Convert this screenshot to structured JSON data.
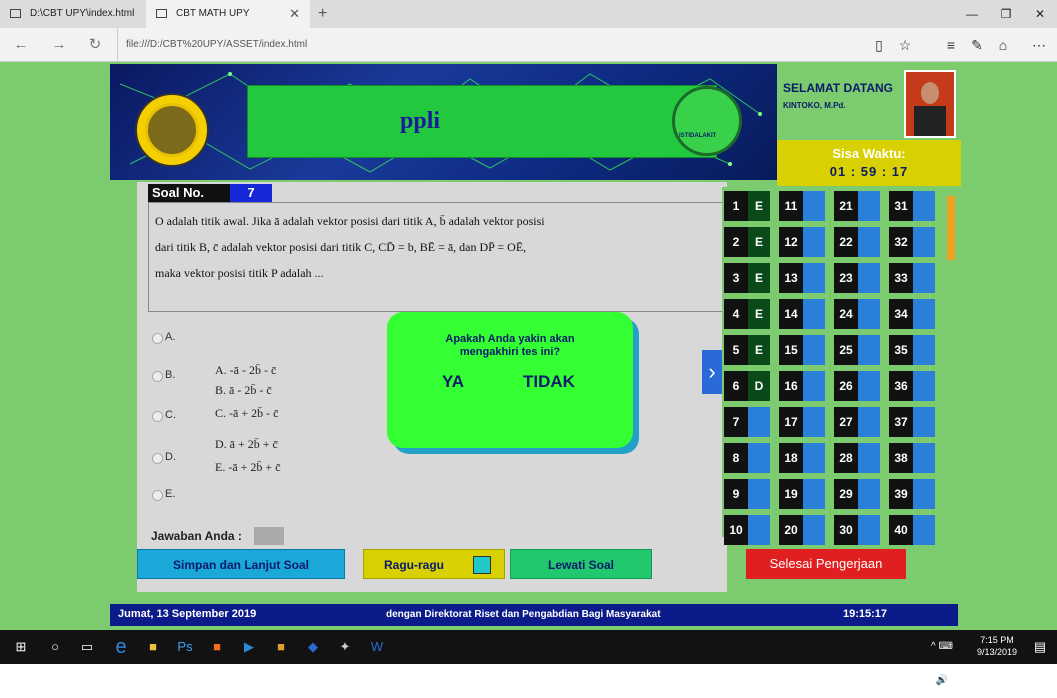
{
  "browser": {
    "tabs": [
      {
        "label": "D:\\CBT UPY\\index.html"
      },
      {
        "label": "CBT MATH UPY"
      }
    ],
    "url": "file:///D:/CBT%20UPY/ASSET/index.html",
    "icons": [
      "back-icon",
      "forward-icon",
      "refresh-icon",
      "reading-view-icon",
      "favorite-star-icon",
      "hub-icon",
      "notes-icon",
      "share-icon",
      "more-icon"
    ]
  },
  "header": {
    "banner_text": "ppli",
    "logo2_text": "ISTIDALAKIT"
  },
  "user": {
    "welcome": "SELAMAT DATANG",
    "name": "KINTOKO, M.Pd."
  },
  "timer": {
    "label": "Sisa Waktu:",
    "value": "01 : 59 : 17"
  },
  "question": {
    "label": "Soal No.",
    "number": "7",
    "lines": [
      "O adalah titik awal. Jika ā adalah vektor posisi dari titik A, b̄ adalah vektor posisi",
      "dari titik B, c̄ adalah vektor posisi dari titik C, CD̄ = b, BĒ = ā, dan DP̄ = OĒ,",
      "maka vektor posisi titik P adalah ..."
    ]
  },
  "options": {
    "labels": [
      "A.",
      "B.",
      "C.",
      "D.",
      "E."
    ],
    "texts": [
      "A. -ā - 2b̄ - c̄",
      "B. ā - 2b̄ - c̄",
      "C. -ā + 2b̄ - c̄",
      "D. ā + 2b̄ + c̄",
      "E. -ā + 2b̄ + c̄"
    ]
  },
  "answer": {
    "label": "Jawaban Anda :"
  },
  "buttons": {
    "simpan": "Simpan dan Lanjut Soal",
    "ragu": "Ragu-ragu",
    "lewati": "Lewati Soal",
    "selesai": "Selesai Pengerjaan"
  },
  "dialog": {
    "message1": "Apakah Anda yakin akan",
    "message2": "mengakhiri tes ini?",
    "yes": "YA",
    "no": "TIDAK"
  },
  "grid": {
    "cells": [
      {
        "n": "1",
        "a": "E"
      },
      {
        "n": "2",
        "a": "E"
      },
      {
        "n": "3",
        "a": "E"
      },
      {
        "n": "4",
        "a": "E"
      },
      {
        "n": "5",
        "a": "E"
      },
      {
        "n": "6",
        "a": "D"
      },
      {
        "n": "7",
        "a": ""
      },
      {
        "n": "8",
        "a": ""
      },
      {
        "n": "9",
        "a": ""
      },
      {
        "n": "10",
        "a": ""
      },
      {
        "n": "11",
        "a": ""
      },
      {
        "n": "12",
        "a": ""
      },
      {
        "n": "13",
        "a": ""
      },
      {
        "n": "14",
        "a": ""
      },
      {
        "n": "15",
        "a": ""
      },
      {
        "n": "16",
        "a": ""
      },
      {
        "n": "17",
        "a": ""
      },
      {
        "n": "18",
        "a": ""
      },
      {
        "n": "19",
        "a": ""
      },
      {
        "n": "20",
        "a": ""
      },
      {
        "n": "21",
        "a": ""
      },
      {
        "n": "22",
        "a": ""
      },
      {
        "n": "23",
        "a": ""
      },
      {
        "n": "24",
        "a": ""
      },
      {
        "n": "25",
        "a": ""
      },
      {
        "n": "26",
        "a": ""
      },
      {
        "n": "27",
        "a": ""
      },
      {
        "n": "28",
        "a": ""
      },
      {
        "n": "29",
        "a": ""
      },
      {
        "n": "30",
        "a": ""
      },
      {
        "n": "31",
        "a": ""
      },
      {
        "n": "32",
        "a": ""
      },
      {
        "n": "33",
        "a": ""
      },
      {
        "n": "34",
        "a": ""
      },
      {
        "n": "35",
        "a": ""
      },
      {
        "n": "36",
        "a": ""
      },
      {
        "n": "37",
        "a": ""
      },
      {
        "n": "38",
        "a": ""
      },
      {
        "n": "39",
        "a": ""
      },
      {
        "n": "40",
        "a": ""
      }
    ]
  },
  "footer": {
    "date": "Jumat, 13 September 2019",
    "running": "dengan Direktorat Riset dan Pengabdian Bagi Masyarakat",
    "time": "19:15:17"
  },
  "taskbar": {
    "time": "7:15 PM",
    "date": "9/13/2019"
  }
}
